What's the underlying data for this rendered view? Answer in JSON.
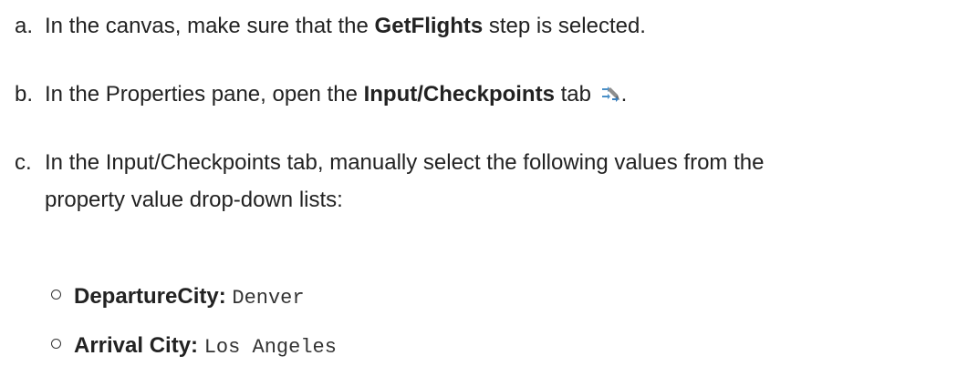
{
  "steps": [
    {
      "marker": "a.",
      "pre": "In the canvas, make sure that the ",
      "bold": "GetFlights",
      "post": " step is selected."
    },
    {
      "marker": "b.",
      "pre": "In the Properties pane, open the ",
      "bold": "Input/Checkpoints",
      "post": " tab",
      "icon": "input-checkpoints-tab-icon",
      "after_icon": "."
    },
    {
      "marker": "c.",
      "line1": "In the Input/Checkpoints tab, manually select the following values from the",
      "line2": "property value drop-down lists:"
    }
  ],
  "values": [
    {
      "label": "DepartureCity:",
      "value": "Denver"
    },
    {
      "label": "Arrival City:",
      "value": "Los Angeles"
    }
  ]
}
